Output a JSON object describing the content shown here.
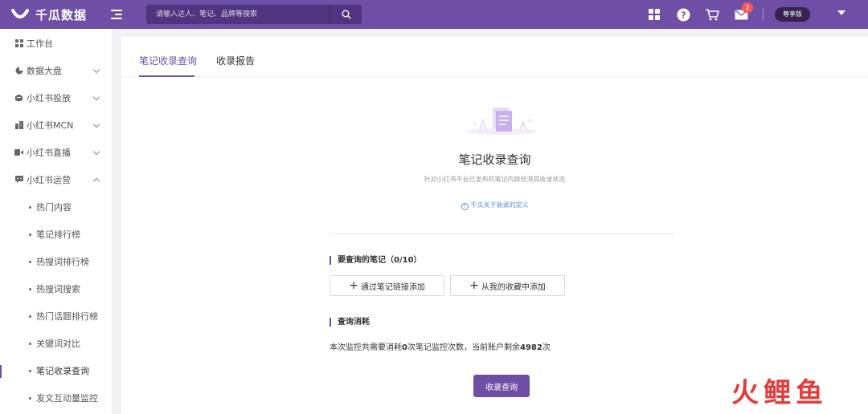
{
  "app": {
    "name": "千瓜数据",
    "search_placeholder": "请输入达人、笔记、品牌等搜索",
    "notification_count": "2",
    "plan": "尊享版"
  },
  "sidebar": {
    "items": [
      {
        "label": "工作台",
        "icon": "grid-icon"
      },
      {
        "label": "数据大盘",
        "icon": "pie-chart-icon"
      },
      {
        "label": "小红书投放",
        "icon": "box-icon"
      },
      {
        "label": "小红书MCN",
        "icon": "building-icon"
      },
      {
        "label": "小红书直播",
        "icon": "video-icon"
      },
      {
        "label": "小红书运营",
        "icon": "message-icon"
      }
    ],
    "sub_items": [
      {
        "label": "热门内容"
      },
      {
        "label": "笔记排行榜"
      },
      {
        "label": "热搜词排行榜"
      },
      {
        "label": "热搜词搜索"
      },
      {
        "label": "热门话题排行榜"
      },
      {
        "label": "关键词对比"
      },
      {
        "label": "笔记收录查询"
      },
      {
        "label": "发文互动量监控"
      }
    ],
    "active_sub": "笔记收录查询"
  },
  "tabs": [
    {
      "label": "笔记收录查询",
      "active": true
    },
    {
      "label": "收录报告",
      "active": false
    }
  ],
  "main": {
    "heading": "笔记收录查询",
    "description": "针对小红书平台已发布的笔记内容检测其收录状态",
    "help_link": "千瓜关于收录的定义",
    "notes_section_title": "要查询的笔记（0/10）",
    "add_by_link": "通过笔记链接添加",
    "add_from_favorites": "从我的收藏中添加",
    "cost_section_title": "查询消耗",
    "cost_prefix": "本次监控共需要消耗",
    "cost_count": "0",
    "cost_middle": "次笔记监控次数，当前账户剩余",
    "remaining": "4982",
    "cost_suffix": "次",
    "query_button": "收录查询"
  },
  "watermark": "火鲤鱼",
  "colors": {
    "brand": "#6f4fa6",
    "badge": "#f55a5a",
    "link": "#5b8ed6"
  }
}
